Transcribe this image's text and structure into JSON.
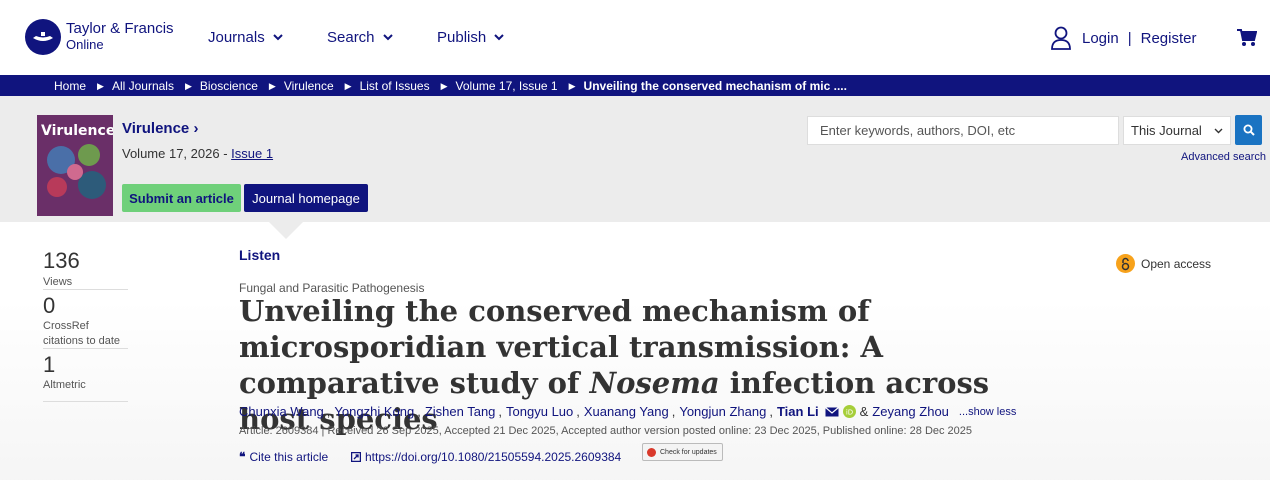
{
  "header": {
    "logo": {
      "line1": "Taylor & Francis",
      "line2": "Online"
    },
    "nav": [
      {
        "label": "Journals"
      },
      {
        "label": "Search"
      },
      {
        "label": "Publish"
      }
    ],
    "login": "Login",
    "separator": "|",
    "register": "Register",
    "icons": {
      "user": "user-icon",
      "cart": "cart-icon"
    }
  },
  "breadcrumb": [
    "Home",
    "All Journals",
    "Bioscience",
    "Virulence",
    "List of Issues",
    "Volume 17, Issue 1",
    "Unveiling the conserved mechanism of mic ...."
  ],
  "journal": {
    "cover_title": "Virulence",
    "name": "Virulence",
    "volume_text": "Volume 17, 2026 - ",
    "issue_link": "Issue 1",
    "submit_label": "Submit an article",
    "homepage_label": "Journal homepage"
  },
  "search": {
    "placeholder": "Enter keywords, authors, DOI, etc",
    "scope": "This Journal",
    "advanced": "Advanced search"
  },
  "metrics": {
    "views": {
      "value": "136",
      "label": "Views"
    },
    "crossref": {
      "value": "0",
      "label1": "CrossRef",
      "label2": "citations to date"
    },
    "altmetric": {
      "value": "1",
      "label": "Altmetric"
    }
  },
  "article": {
    "listen": "Listen",
    "open_access": "Open access",
    "subject": "Fungal and Parasitic Pathogenesis",
    "title_part1": "Unveiling the conserved mechanism of microsporidian vertical transmission: A comparative study of ",
    "title_italic": "Nosema",
    "title_part2": " infection across host species",
    "authors": [
      "Chunxia Wang",
      "Yongzhi Kong",
      "Zishen Tang",
      "Tongyu Luo",
      "Xuanang Yang",
      "Yongjun Zhang",
      "Tian Li",
      "Zeyang Zhou"
    ],
    "ampersand": "&",
    "show_less": "...show less",
    "meta": "Article: 2609384 | Received 26 Sep 2025, Accepted 21 Dec 2025, Accepted author version posted online: 23 Dec 2025, Published online: 28 Dec 2025",
    "cite_label": "Cite this article",
    "doi_link": "https://doi.org/10.1080/21505594.2025.2609384",
    "check_updates": "Check for updates"
  },
  "colors": {
    "brand_navy": "#10147e",
    "submit_green": "#6fd07a",
    "search_blue": "#1a73c2",
    "open_access_orange": "#f7a21b",
    "orcid_green": "#a6ce39"
  }
}
